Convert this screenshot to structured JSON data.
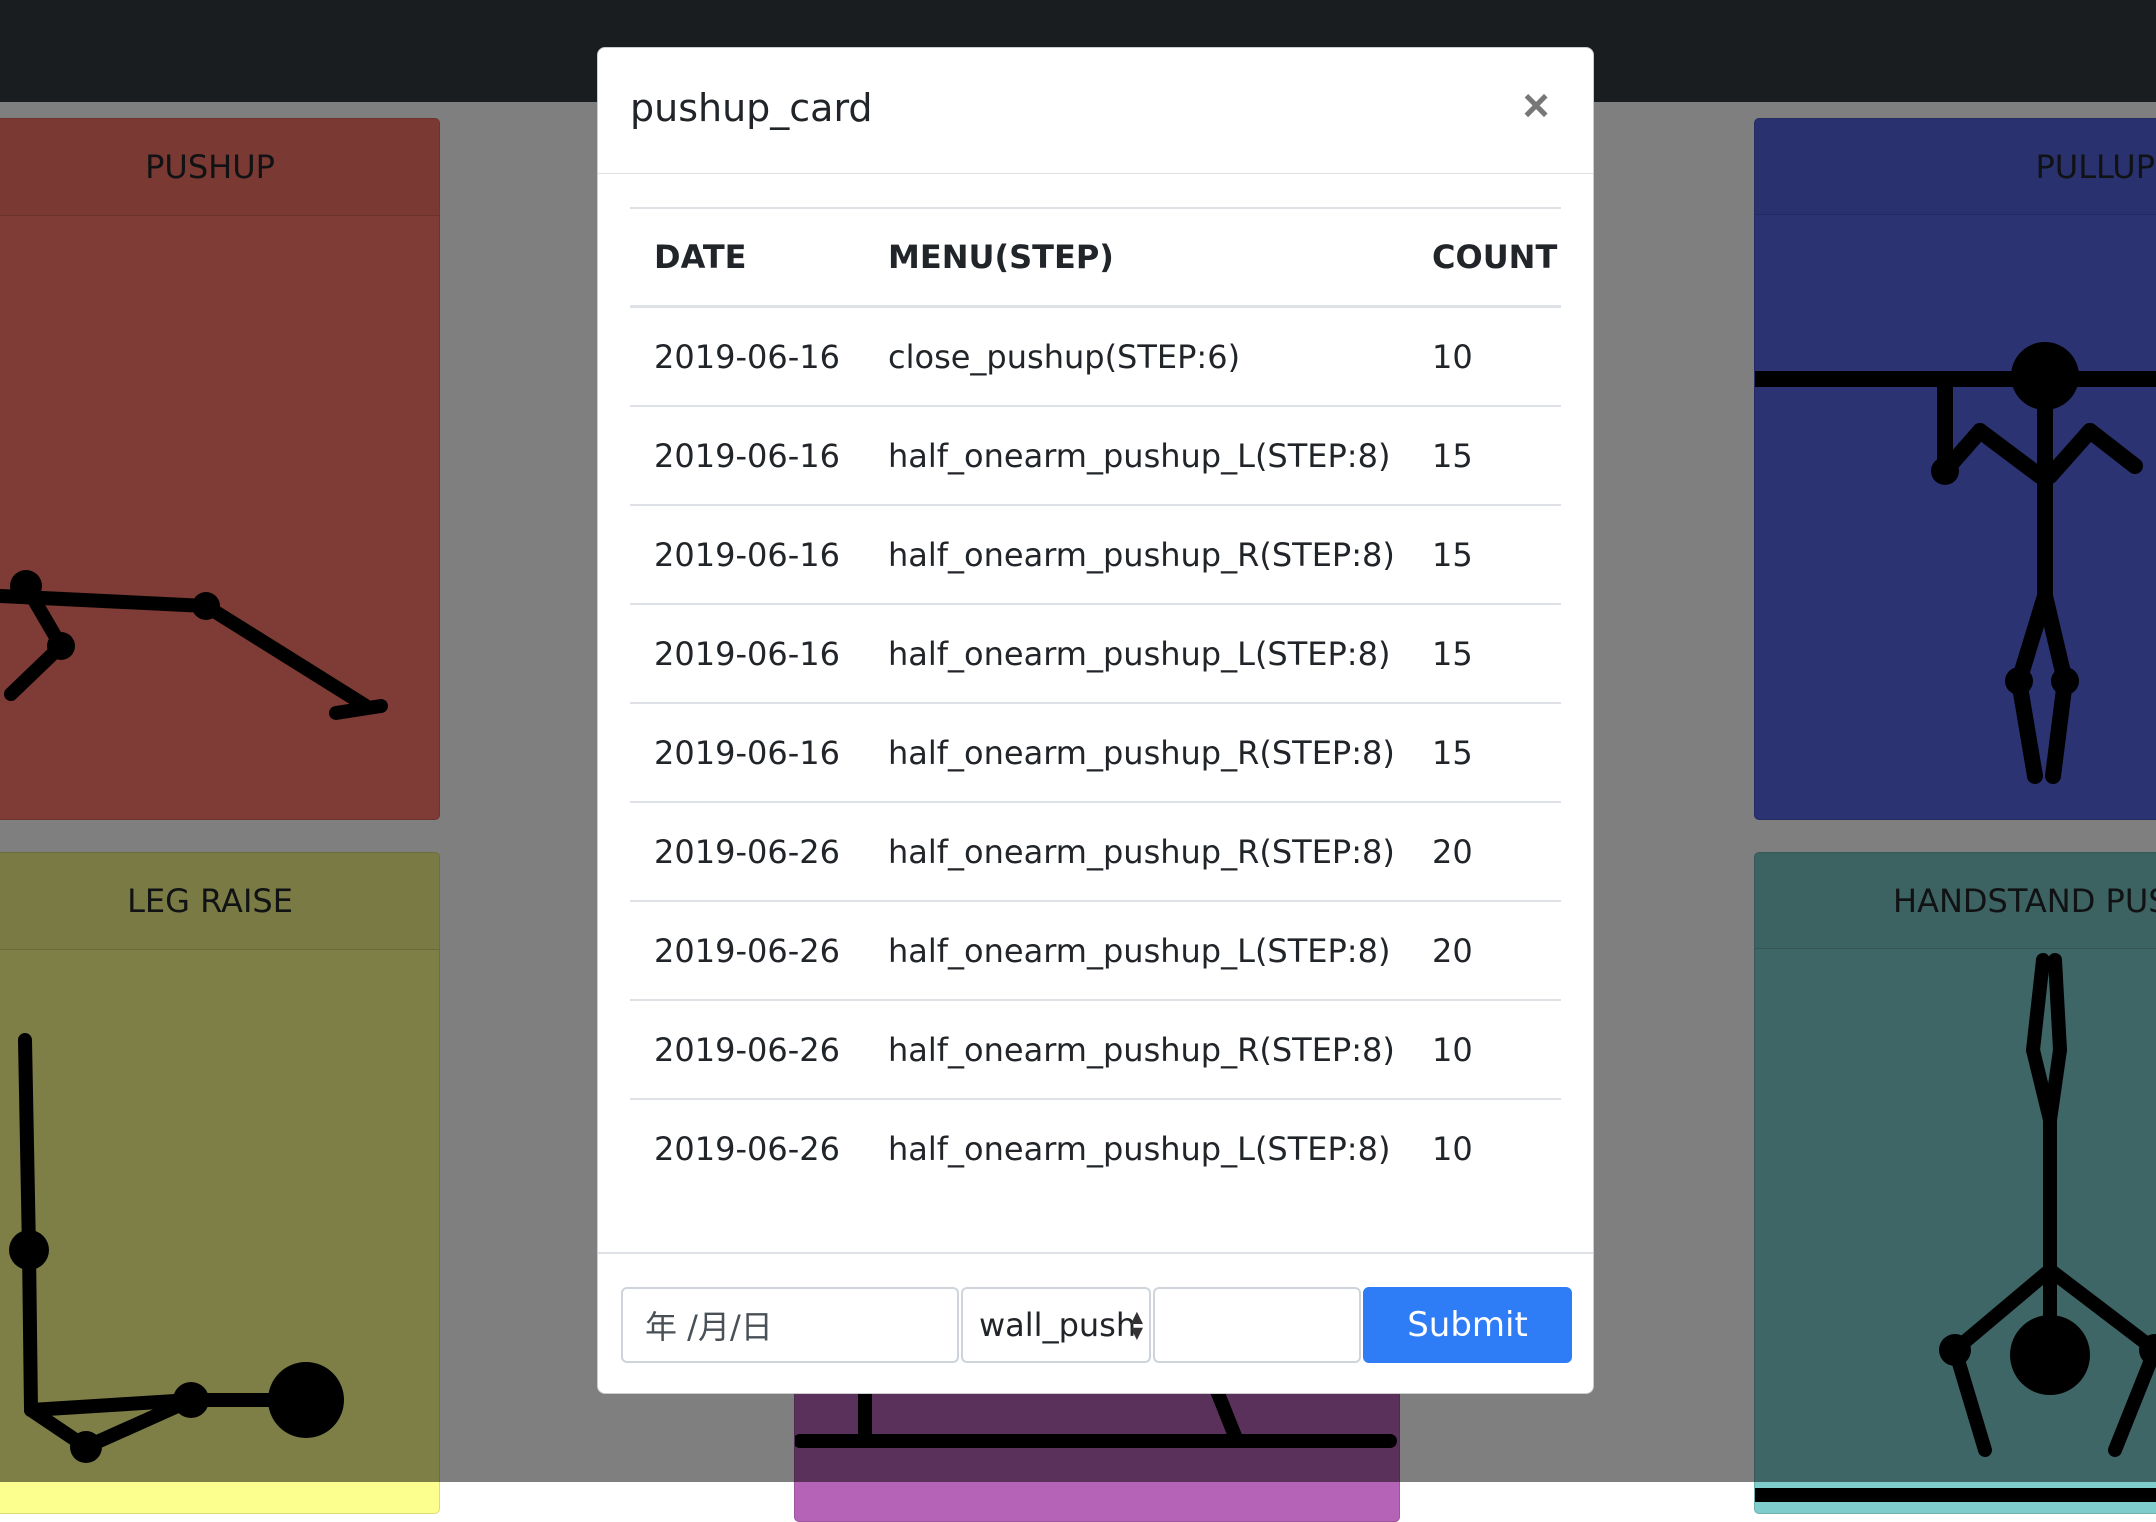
{
  "cards": {
    "pushup_title": "PUSHUP",
    "pullup_title": "PULLUP",
    "legraise_title": "LEG RAISE",
    "handstand_title": "HANDSTAND PUS"
  },
  "modal": {
    "title": "pushup_card",
    "close_symbol": "×",
    "table": {
      "headers": [
        "DATE",
        "MENU(STEP)",
        "COUNT"
      ],
      "rows": [
        {
          "date": "2019-06-16",
          "menu": "close_pushup(STEP:6)",
          "count": "10"
        },
        {
          "date": "2019-06-16",
          "menu": "half_onearm_pushup_L(STEP:8)",
          "count": "15"
        },
        {
          "date": "2019-06-16",
          "menu": "half_onearm_pushup_R(STEP:8)",
          "count": "15"
        },
        {
          "date": "2019-06-16",
          "menu": "half_onearm_pushup_L(STEP:8)",
          "count": "15"
        },
        {
          "date": "2019-06-16",
          "menu": "half_onearm_pushup_R(STEP:8)",
          "count": "15"
        },
        {
          "date": "2019-06-26",
          "menu": "half_onearm_pushup_R(STEP:8)",
          "count": "20"
        },
        {
          "date": "2019-06-26",
          "menu": "half_onearm_pushup_L(STEP:8)",
          "count": "20"
        },
        {
          "date": "2019-06-26",
          "menu": "half_onearm_pushup_R(STEP:8)",
          "count": "10"
        },
        {
          "date": "2019-06-26",
          "menu": "half_onearm_pushup_L(STEP:8)",
          "count": "10"
        }
      ]
    },
    "footer": {
      "date_placeholder": "年 /月/日",
      "menu_selected": "wall_push",
      "count_value": "",
      "submit_label": "Submit"
    }
  },
  "colors": {
    "navbar": "#343a40",
    "pushup_card": "#fe766a",
    "pullup_card": "#5766e6",
    "legraise_card": "#fcfe8e",
    "handstand_card": "#7fcccc",
    "bottom_card": "#b463b6",
    "submit_button": "#2f7df6"
  }
}
